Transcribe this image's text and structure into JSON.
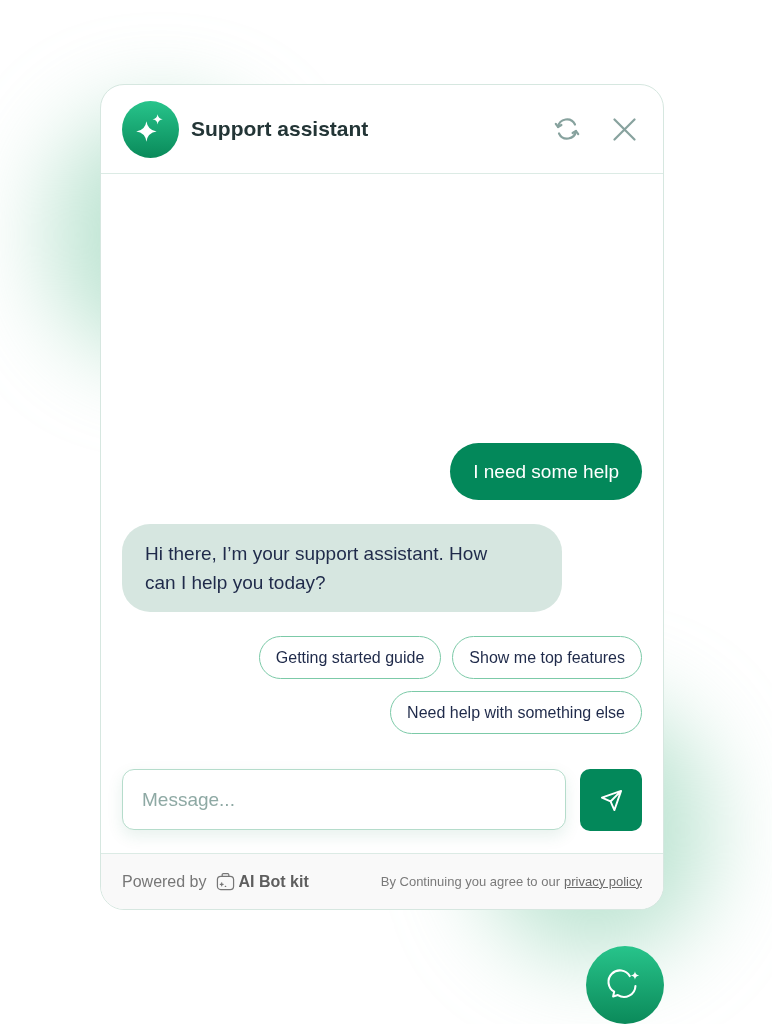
{
  "header": {
    "title": "Support assistant"
  },
  "messages": [
    {
      "kind": "user",
      "text": "I need some help"
    },
    {
      "kind": "bot",
      "text": "Hi there, I’m your support assistant. How can I help you today?"
    }
  ],
  "quick_replies": [
    "Getting started guide",
    "Show me top features",
    "Need help with something else"
  ],
  "composer": {
    "placeholder": "Message..."
  },
  "footer": {
    "powered_by": "Powered by",
    "brand": "AI Bot kit",
    "consent": "By Continuing you agree to our",
    "link": "privacy policy"
  }
}
